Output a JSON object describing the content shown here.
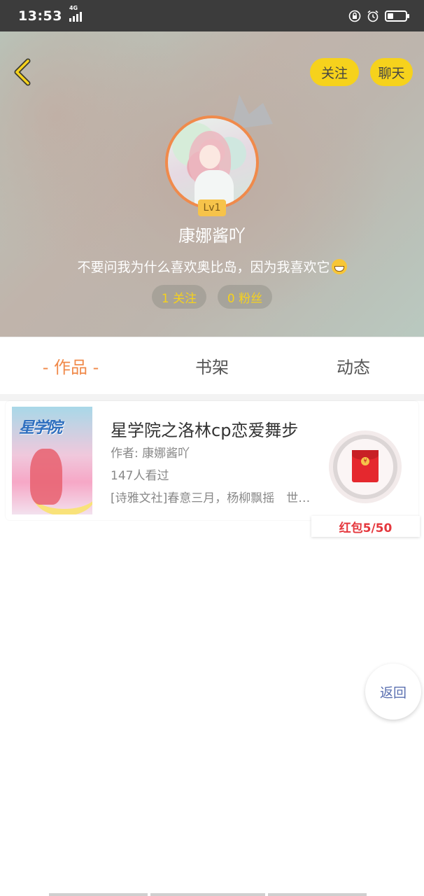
{
  "status_bar": {
    "time": "13:53",
    "network": "4G",
    "icons": [
      "lock-rotation-icon",
      "alarm-icon",
      "battery-icon"
    ]
  },
  "header": {
    "follow_label": "关注",
    "chat_label": "聊天",
    "level": "Lv1",
    "nickname": "康娜酱吖",
    "bio": "不要问我为什么喜欢奥比岛，因为我喜欢它",
    "bio_emoji": "grinning-face-icon",
    "following": "1 关注",
    "fans": "0 粉丝",
    "colors": {
      "accent": "#f6d21c",
      "avatar_ring": "#f08a4b"
    }
  },
  "tabs": [
    {
      "label": "- 作品 -",
      "active": true
    },
    {
      "label": "书架",
      "active": false
    },
    {
      "label": "动态",
      "active": false
    }
  ],
  "works": [
    {
      "cover_text": "星学院",
      "title": "星学院之洛林cp恋爱舞步",
      "author": "作者: 康娜酱吖",
      "views": "147人看过",
      "description": "[诗雅文社]春意三月，杨柳飘摇　世…"
    }
  ],
  "red_packet": {
    "label": "红包5/50",
    "color": "#e5383e"
  },
  "return_button": {
    "label": "返回"
  }
}
